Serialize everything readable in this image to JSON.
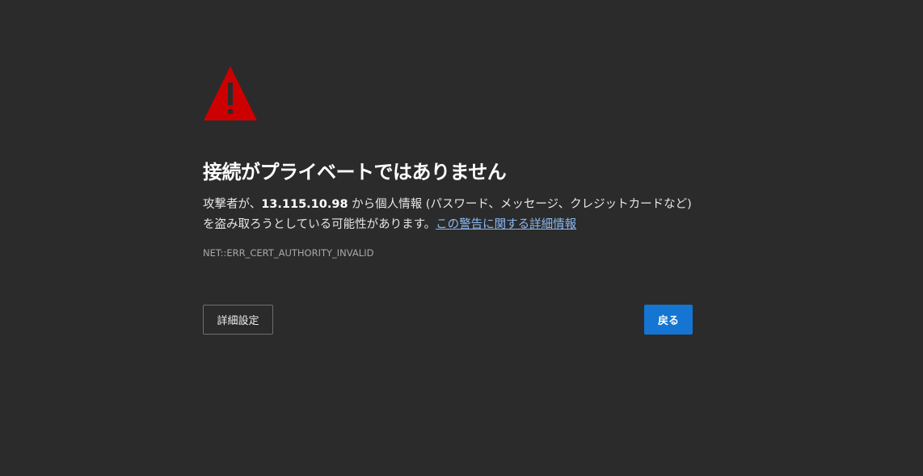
{
  "title": "接続がプライベートではありません",
  "description": {
    "part1": "攻撃者が、",
    "host": "13.115.10.98",
    "part2": " から個人情報 (パスワード、メッセージ、クレジットカードなど) を盗み取ろうとしている可能性があります。",
    "learn_more_link": "この警告に関する詳細情報"
  },
  "error_code": "NET::ERR_CERT_AUTHORITY_INVALID",
  "buttons": {
    "advanced_label": "詳細設定",
    "back_label": "戻る"
  },
  "colors": {
    "background": "#2b2b2b",
    "warning_red": "#cc0000",
    "link": "#8ab8f0",
    "primary_button": "#1475d2"
  }
}
